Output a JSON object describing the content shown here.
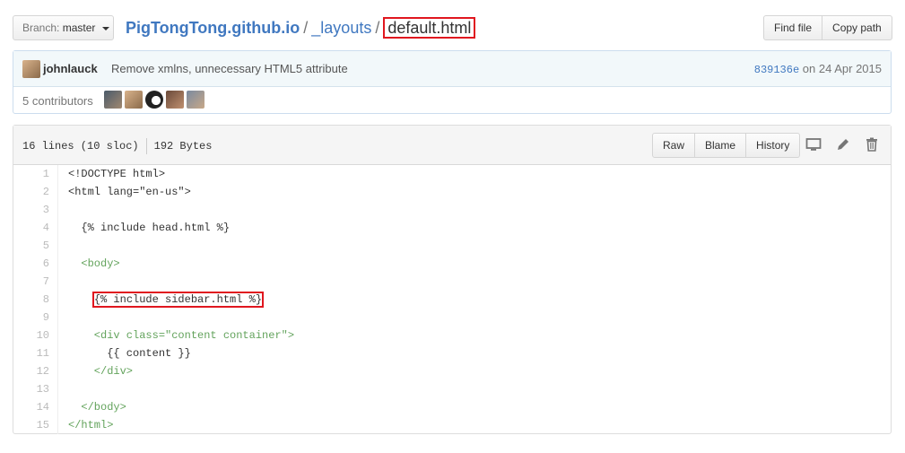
{
  "branch": {
    "label": "Branch:",
    "value": "master"
  },
  "breadcrumb": {
    "repo": "PigTongTong.github.io",
    "sep": "/",
    "dir": "_layouts",
    "file": "default.html"
  },
  "header_buttons": {
    "find_file": "Find file",
    "copy_path": "Copy path"
  },
  "commit": {
    "author": "johnlauck",
    "message": "Remove xmlns, unnecessary HTML5 attribute",
    "sha": "839136e",
    "date": "on 24 Apr 2015"
  },
  "contributors": {
    "label": "5 contributors"
  },
  "file": {
    "lines_info": "16 lines (10 sloc)",
    "size": "192 Bytes",
    "buttons": {
      "raw": "Raw",
      "blame": "Blame",
      "history": "History"
    }
  },
  "code_lines": [
    {
      "n": "1",
      "text": "<!DOCTYPE html>"
    },
    {
      "n": "2",
      "text": "<html lang=\"en-us\">"
    },
    {
      "n": "3",
      "text": ""
    },
    {
      "n": "4",
      "text": "  {% include head.html %}"
    },
    {
      "n": "5",
      "text": ""
    },
    {
      "n": "6",
      "text": "  <body>"
    },
    {
      "n": "7",
      "text": ""
    },
    {
      "n": "8",
      "text": "    {% include sidebar.html %}"
    },
    {
      "n": "9",
      "text": ""
    },
    {
      "n": "10",
      "text": "    <div class=\"content container\">"
    },
    {
      "n": "11",
      "text": "      {{ content }}"
    },
    {
      "n": "12",
      "text": "    </div>"
    },
    {
      "n": "13",
      "text": ""
    },
    {
      "n": "14",
      "text": "  </body>"
    },
    {
      "n": "15",
      "text": "</html>"
    }
  ],
  "colors": {
    "accent_link": "#4078c0",
    "highlight_box": "#e0171f"
  }
}
